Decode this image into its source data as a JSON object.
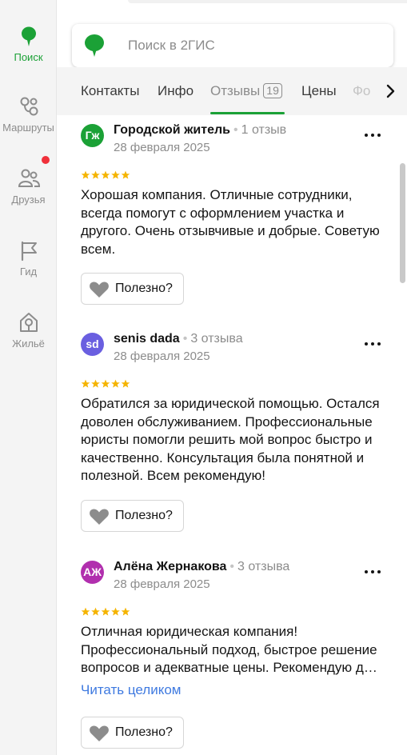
{
  "colors": {
    "brand": "#1ba136",
    "link": "#3f7ae0",
    "star": "#f5b400",
    "notify": "#f0303a"
  },
  "rail": [
    {
      "label": "Поиск",
      "icon": "search-pin-icon",
      "active": true
    },
    {
      "label": "Маршруты",
      "icon": "routes-icon"
    },
    {
      "label": "Друзья",
      "icon": "friends-icon"
    },
    {
      "label": "Гид",
      "icon": "flag-icon"
    },
    {
      "label": "Жильё",
      "icon": "house-icon"
    }
  ],
  "search": {
    "placeholder": "Поиск в 2ГИС",
    "icon": "2gis-logo-icon"
  },
  "tabs": [
    {
      "label": "Контакты"
    },
    {
      "label": "Инфо"
    },
    {
      "label": "Отзывы",
      "badge": "19",
      "active": true
    },
    {
      "label": "Цены"
    },
    {
      "label": "Фо"
    }
  ],
  "reviews": [
    {
      "initials": "Гж",
      "avatar_color": "#1ba136",
      "author": "Городской житель",
      "count": "1 отзыв",
      "date": "28 февраля 2025",
      "rating": 5,
      "text": "Хорошая компания. Отличные сотрудники, всегда помогут с оформлением участка и другого. Очень отзывчивые и добрые. Советую всем.",
      "useful": "Полезно?"
    },
    {
      "initials": "sd",
      "avatar_color": "#6a5fe0",
      "author": "senis dada",
      "count": "3 отзыва",
      "date": "28 февраля 2025",
      "rating": 5,
      "text": "Обратился за юридической помощью. Остался доволен обслуживанием. Профессиональные юристы помогли решить мой вопрос быстро и качественно. Консультация была понятной и полезной. Всем рекомендую!",
      "useful": "Полезно?"
    },
    {
      "initials": "АЖ",
      "avatar_color": "#b12fae",
      "author": "Алёна Жернакова",
      "count": "3 отзыва",
      "date": "28 февраля 2025",
      "rating": 5,
      "text": "Отличная юридическая компания! Профессиональный подход, быстрое решение вопросов и адекватные цены. Рекомендую д…",
      "read_more": "Читать целиком",
      "useful": "Полезно?"
    }
  ]
}
